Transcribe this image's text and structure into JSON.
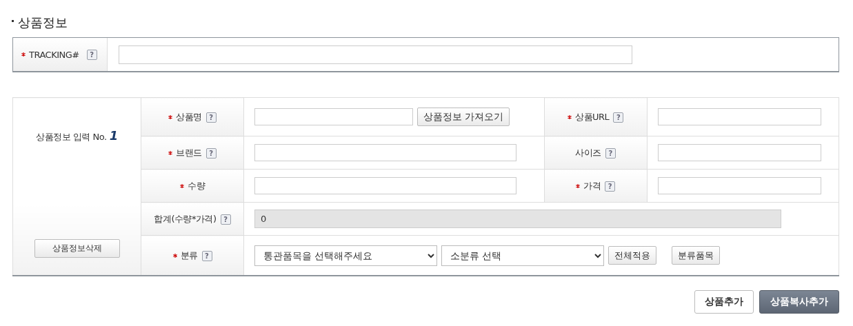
{
  "section_title": "상품정보",
  "tracking": {
    "label": "TRACKING#",
    "required": true,
    "help": "?"
  },
  "product": {
    "heading": "상품정보 입력 No.",
    "number": "1",
    "delete_button": "상품정보삭제",
    "rows": [
      {
        "fields": [
          {
            "kind": "text-with-button",
            "label": "상품명",
            "required": true,
            "help": "?",
            "button": "상품정보 가져오기"
          },
          {
            "kind": "text",
            "label": "상품URL",
            "required": true,
            "help": "?"
          }
        ]
      },
      {
        "fields": [
          {
            "kind": "text",
            "label": "브랜드",
            "required": true,
            "help": "?"
          },
          {
            "kind": "text",
            "label": "사이즈",
            "required": false,
            "help": "?"
          }
        ]
      },
      {
        "fields": [
          {
            "kind": "text",
            "label": "수량",
            "required": true
          },
          {
            "kind": "text",
            "label": "가격",
            "required": true,
            "help": "?"
          }
        ]
      },
      {
        "fields": [
          {
            "kind": "readonly",
            "label": "합계(수량*가격)",
            "required": false,
            "help": "?",
            "value": "0"
          }
        ]
      },
      {
        "fields": [
          {
            "kind": "category",
            "label": "분류",
            "required": true,
            "help": "?",
            "selects": [
              "통관품목을 선택해주세요",
              "소분류 선택"
            ],
            "buttons": [
              "전체적용",
              "분류품목"
            ]
          }
        ]
      }
    ]
  },
  "actions": [
    {
      "label": "상품추가",
      "kind": "plain"
    },
    {
      "label": "상품복사추가",
      "kind": "dark"
    }
  ]
}
